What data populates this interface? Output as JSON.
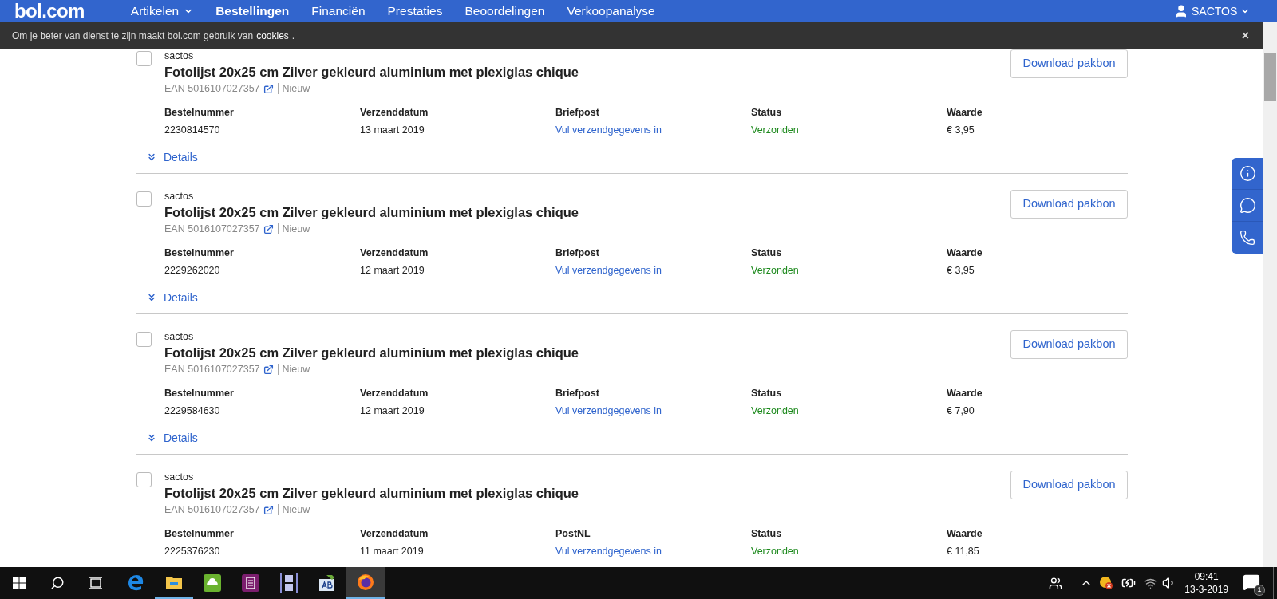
{
  "nav": {
    "logo": "bol.com",
    "items": [
      {
        "label": "Artikelen",
        "selected": false,
        "dropdown": true
      },
      {
        "label": "Bestellingen",
        "selected": true,
        "dropdown": false
      },
      {
        "label": "Financiën",
        "selected": false,
        "dropdown": false
      },
      {
        "label": "Prestaties",
        "selected": false,
        "dropdown": false
      },
      {
        "label": "Beoordelingen",
        "selected": false,
        "dropdown": false
      },
      {
        "label": "Verkoopanalyse",
        "selected": false,
        "dropdown": false
      }
    ],
    "user": "SACTOS"
  },
  "cookie_bar": {
    "text": "Om je beter van dienst te zijn maakt bol.com gebruik van",
    "link": "cookies",
    "suffix": ".",
    "close": "×"
  },
  "orders": [
    {
      "checked": false,
      "seller": "sactos",
      "title": "Fotolijst 20x25 cm Zilver gekleurd aluminium met plexiglas chique",
      "ean": "EAN 5016107027357",
      "condition": "Nieuw",
      "button": "Download pakbon",
      "details": "Details",
      "fields": [
        {
          "label": "Bestelnummer",
          "value": "2230814570",
          "kind": "text"
        },
        {
          "label": "Verzenddatum",
          "value": "13 maart 2019",
          "kind": "text"
        },
        {
          "label": "Briefpost",
          "value": "Vul verzendgegevens in",
          "kind": "link"
        },
        {
          "label": "Status",
          "value": "Verzonden",
          "kind": "status"
        },
        {
          "label": "Waarde",
          "value": "€ 3,95",
          "kind": "text"
        }
      ]
    },
    {
      "checked": false,
      "seller": "sactos",
      "title": "Fotolijst 20x25 cm Zilver gekleurd aluminium met plexiglas chique",
      "ean": "EAN 5016107027357",
      "condition": "Nieuw",
      "button": "Download pakbon",
      "details": "Details",
      "fields": [
        {
          "label": "Bestelnummer",
          "value": "2229262020",
          "kind": "text"
        },
        {
          "label": "Verzenddatum",
          "value": "12 maart 2019",
          "kind": "text"
        },
        {
          "label": "Briefpost",
          "value": "Vul verzendgegevens in",
          "kind": "link"
        },
        {
          "label": "Status",
          "value": "Verzonden",
          "kind": "status"
        },
        {
          "label": "Waarde",
          "value": "€ 3,95",
          "kind": "text"
        }
      ]
    },
    {
      "checked": false,
      "seller": "sactos",
      "title": "Fotolijst 20x25 cm Zilver gekleurd aluminium met plexiglas chique",
      "ean": "EAN 5016107027357",
      "condition": "Nieuw",
      "button": "Download pakbon",
      "details": "Details",
      "fields": [
        {
          "label": "Bestelnummer",
          "value": "2229584630",
          "kind": "text"
        },
        {
          "label": "Verzenddatum",
          "value": "12 maart 2019",
          "kind": "text"
        },
        {
          "label": "Briefpost",
          "value": "Vul verzendgegevens in",
          "kind": "link"
        },
        {
          "label": "Status",
          "value": "Verzonden",
          "kind": "status"
        },
        {
          "label": "Waarde",
          "value": "€ 7,90",
          "kind": "text"
        }
      ]
    },
    {
      "checked": false,
      "seller": "sactos",
      "title": "Fotolijst 20x25 cm Zilver gekleurd aluminium met plexiglas chique",
      "ean": "EAN 5016107027357",
      "condition": "Nieuw",
      "button": "Download pakbon",
      "fields": [
        {
          "label": "Bestelnummer",
          "value": "2225376230",
          "kind": "text"
        },
        {
          "label": "Verzenddatum",
          "value": "11 maart 2019",
          "kind": "text"
        },
        {
          "label": "PostNL",
          "value": "Vul verzendgegevens in",
          "kind": "link"
        },
        {
          "label": "Status",
          "value": "Verzonden",
          "kind": "status"
        },
        {
          "label": "Waarde",
          "value": "€ 11,85",
          "kind": "text"
        }
      ]
    }
  ],
  "taskbar": {
    "time": "09:41",
    "date": "13-3-2019",
    "notifications": "1"
  }
}
